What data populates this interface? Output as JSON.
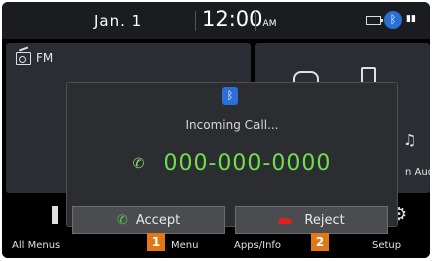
{
  "status_bar": {
    "date": "Jan. 1",
    "time": "12:00",
    "ampm": "AM"
  },
  "home": {
    "fm_label": "FM",
    "media_label": "n Audio"
  },
  "bottom_menu": {
    "items": [
      "All Menus",
      "Menu",
      "Apps/Info",
      "Setup"
    ]
  },
  "popup": {
    "title": "Incoming Call...",
    "number": "000-000-0000",
    "accept_label": "Accept",
    "reject_label": "Reject"
  },
  "callouts": [
    "1",
    "2"
  ],
  "colors": {
    "number": "#6ee04e",
    "accept_icon": "#58c44a",
    "reject_icon": "#e02020",
    "bluetooth": "#2c6fd8",
    "callout": "#e07818"
  },
  "icons": [
    "bluetooth-icon",
    "phone-incoming-icon",
    "phone-accept-icon",
    "phone-reject-icon",
    "radio-icon",
    "battery-icon",
    "signal-icon"
  ]
}
